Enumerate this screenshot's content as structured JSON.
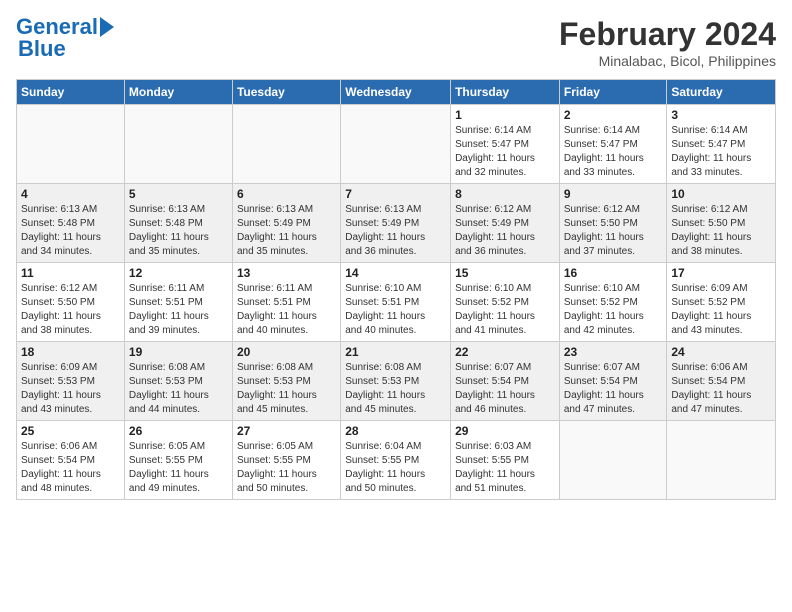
{
  "header": {
    "logo_line1": "General",
    "logo_line2": "Blue",
    "month_year": "February 2024",
    "location": "Minalabac, Bicol, Philippines"
  },
  "weekdays": [
    "Sunday",
    "Monday",
    "Tuesday",
    "Wednesday",
    "Thursday",
    "Friday",
    "Saturday"
  ],
  "weeks": [
    [
      {
        "day": "",
        "info": ""
      },
      {
        "day": "",
        "info": ""
      },
      {
        "day": "",
        "info": ""
      },
      {
        "day": "",
        "info": ""
      },
      {
        "day": "1",
        "info": "Sunrise: 6:14 AM\nSunset: 5:47 PM\nDaylight: 11 hours\nand 32 minutes."
      },
      {
        "day": "2",
        "info": "Sunrise: 6:14 AM\nSunset: 5:47 PM\nDaylight: 11 hours\nand 33 minutes."
      },
      {
        "day": "3",
        "info": "Sunrise: 6:14 AM\nSunset: 5:47 PM\nDaylight: 11 hours\nand 33 minutes."
      }
    ],
    [
      {
        "day": "4",
        "info": "Sunrise: 6:13 AM\nSunset: 5:48 PM\nDaylight: 11 hours\nand 34 minutes."
      },
      {
        "day": "5",
        "info": "Sunrise: 6:13 AM\nSunset: 5:48 PM\nDaylight: 11 hours\nand 35 minutes."
      },
      {
        "day": "6",
        "info": "Sunrise: 6:13 AM\nSunset: 5:49 PM\nDaylight: 11 hours\nand 35 minutes."
      },
      {
        "day": "7",
        "info": "Sunrise: 6:13 AM\nSunset: 5:49 PM\nDaylight: 11 hours\nand 36 minutes."
      },
      {
        "day": "8",
        "info": "Sunrise: 6:12 AM\nSunset: 5:49 PM\nDaylight: 11 hours\nand 36 minutes."
      },
      {
        "day": "9",
        "info": "Sunrise: 6:12 AM\nSunset: 5:50 PM\nDaylight: 11 hours\nand 37 minutes."
      },
      {
        "day": "10",
        "info": "Sunrise: 6:12 AM\nSunset: 5:50 PM\nDaylight: 11 hours\nand 38 minutes."
      }
    ],
    [
      {
        "day": "11",
        "info": "Sunrise: 6:12 AM\nSunset: 5:50 PM\nDaylight: 11 hours\nand 38 minutes."
      },
      {
        "day": "12",
        "info": "Sunrise: 6:11 AM\nSunset: 5:51 PM\nDaylight: 11 hours\nand 39 minutes."
      },
      {
        "day": "13",
        "info": "Sunrise: 6:11 AM\nSunset: 5:51 PM\nDaylight: 11 hours\nand 40 minutes."
      },
      {
        "day": "14",
        "info": "Sunrise: 6:10 AM\nSunset: 5:51 PM\nDaylight: 11 hours\nand 40 minutes."
      },
      {
        "day": "15",
        "info": "Sunrise: 6:10 AM\nSunset: 5:52 PM\nDaylight: 11 hours\nand 41 minutes."
      },
      {
        "day": "16",
        "info": "Sunrise: 6:10 AM\nSunset: 5:52 PM\nDaylight: 11 hours\nand 42 minutes."
      },
      {
        "day": "17",
        "info": "Sunrise: 6:09 AM\nSunset: 5:52 PM\nDaylight: 11 hours\nand 43 minutes."
      }
    ],
    [
      {
        "day": "18",
        "info": "Sunrise: 6:09 AM\nSunset: 5:53 PM\nDaylight: 11 hours\nand 43 minutes."
      },
      {
        "day": "19",
        "info": "Sunrise: 6:08 AM\nSunset: 5:53 PM\nDaylight: 11 hours\nand 44 minutes."
      },
      {
        "day": "20",
        "info": "Sunrise: 6:08 AM\nSunset: 5:53 PM\nDaylight: 11 hours\nand 45 minutes."
      },
      {
        "day": "21",
        "info": "Sunrise: 6:08 AM\nSunset: 5:53 PM\nDaylight: 11 hours\nand 45 minutes."
      },
      {
        "day": "22",
        "info": "Sunrise: 6:07 AM\nSunset: 5:54 PM\nDaylight: 11 hours\nand 46 minutes."
      },
      {
        "day": "23",
        "info": "Sunrise: 6:07 AM\nSunset: 5:54 PM\nDaylight: 11 hours\nand 47 minutes."
      },
      {
        "day": "24",
        "info": "Sunrise: 6:06 AM\nSunset: 5:54 PM\nDaylight: 11 hours\nand 47 minutes."
      }
    ],
    [
      {
        "day": "25",
        "info": "Sunrise: 6:06 AM\nSunset: 5:54 PM\nDaylight: 11 hours\nand 48 minutes."
      },
      {
        "day": "26",
        "info": "Sunrise: 6:05 AM\nSunset: 5:55 PM\nDaylight: 11 hours\nand 49 minutes."
      },
      {
        "day": "27",
        "info": "Sunrise: 6:05 AM\nSunset: 5:55 PM\nDaylight: 11 hours\nand 50 minutes."
      },
      {
        "day": "28",
        "info": "Sunrise: 6:04 AM\nSunset: 5:55 PM\nDaylight: 11 hours\nand 50 minutes."
      },
      {
        "day": "29",
        "info": "Sunrise: 6:03 AM\nSunset: 5:55 PM\nDaylight: 11 hours\nand 51 minutes."
      },
      {
        "day": "",
        "info": ""
      },
      {
        "day": "",
        "info": ""
      }
    ]
  ]
}
